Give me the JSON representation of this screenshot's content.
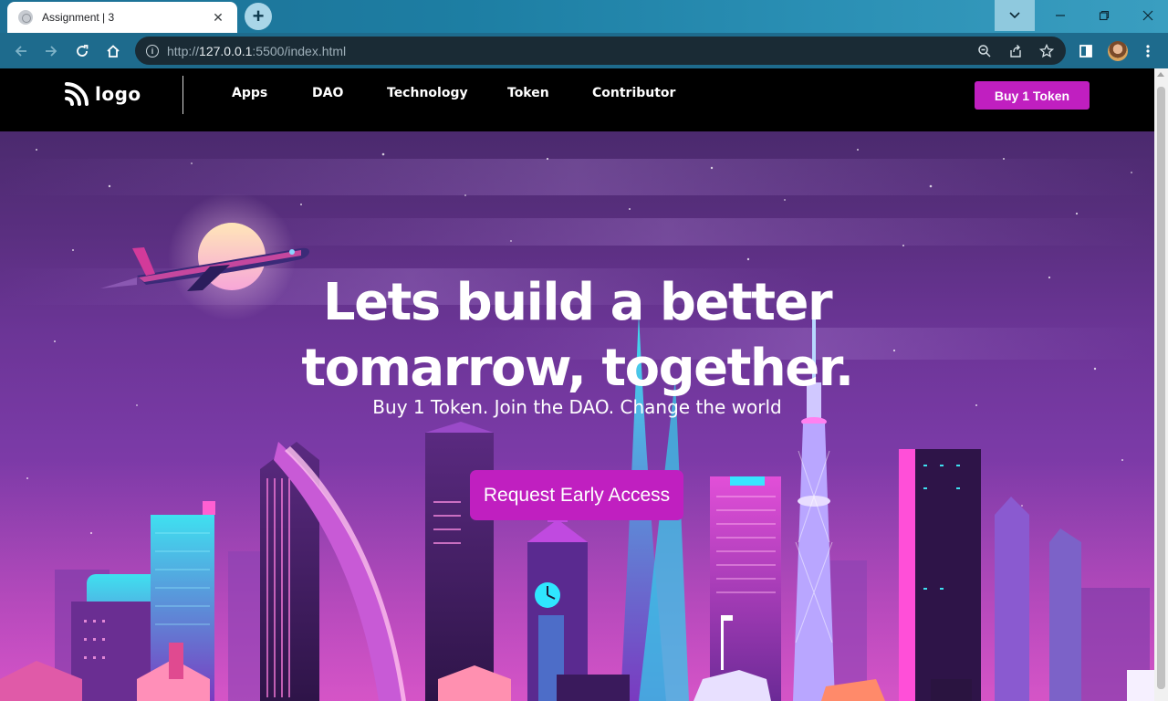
{
  "browser": {
    "tab_title": "Assignment | 3",
    "url_prefix": "http://",
    "url_host": "127.0.0.1",
    "url_rest": ":5500/index.html"
  },
  "site": {
    "logo_text": "logo",
    "nav": [
      "Apps",
      "DAO",
      "Technology",
      "Token",
      "Contributor"
    ],
    "buy_button": "Buy 1 Token",
    "hero": {
      "title_line1": "Lets build a better",
      "title_line2": "tomarrow, together.",
      "subtitle": "Buy 1 Token. Join the DAO. Change the world",
      "cta": "Request Early Access"
    }
  },
  "colors": {
    "accent": "#c01fc0",
    "navbar_bg": "#000000",
    "chrome_frame": "#1e6b8d"
  },
  "icons": [
    "globe-icon",
    "close-icon",
    "plus-icon",
    "chevron-down-icon",
    "minimize-icon",
    "restore-icon",
    "window-close-icon",
    "back-icon",
    "forward-icon",
    "reload-icon",
    "home-icon",
    "info-icon",
    "zoom-icon",
    "share-icon",
    "star-icon",
    "side-panel-icon",
    "menu-icon",
    "logo-icon"
  ]
}
